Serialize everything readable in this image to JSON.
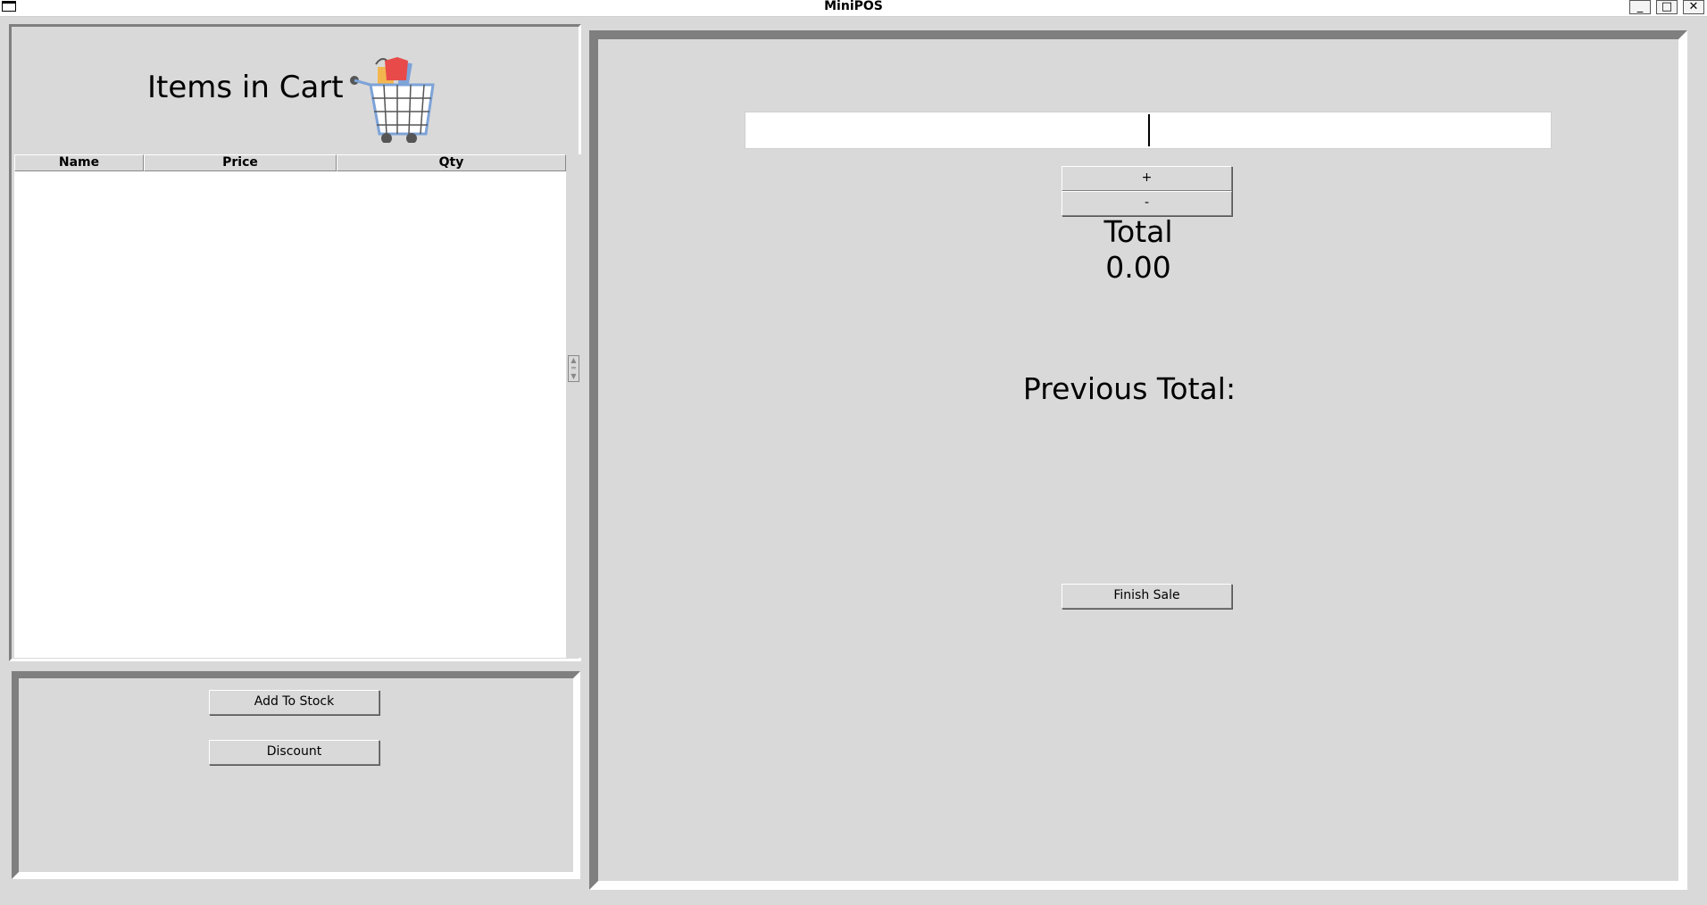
{
  "window": {
    "title": "MiniPOS",
    "controls": [
      "_",
      "□",
      "✕"
    ]
  },
  "cart": {
    "title": "Items in Cart",
    "columns": [
      "Name",
      "Price",
      "Qty"
    ],
    "rows": []
  },
  "actions": {
    "add_to_stock_label": "Add To Stock",
    "discount_label": "Discount"
  },
  "main": {
    "barcode_value": "",
    "plus_label": "+",
    "minus_label": "-",
    "total_label": "Total",
    "total_value": "0.00",
    "previous_total_label": "Previous Total:",
    "finish_sale_label": "Finish Sale"
  }
}
